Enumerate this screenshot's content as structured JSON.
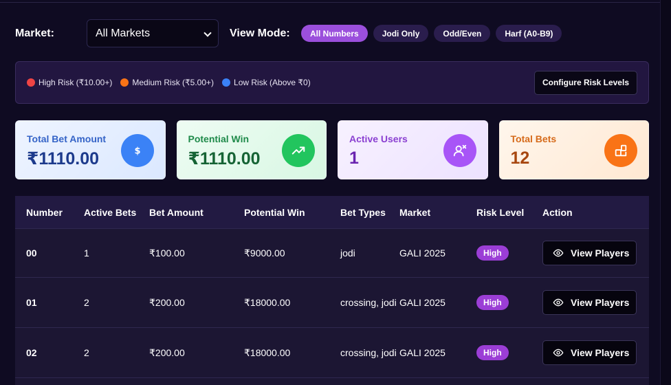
{
  "filters": {
    "market_label": "Market:",
    "market_selected": "All Markets",
    "view_mode_label": "View Mode:",
    "view_modes": [
      "All Numbers",
      "Jodi Only",
      "Odd/Even",
      "Harf (A0-B9)"
    ],
    "active_view_mode": "All Numbers"
  },
  "risk_legend": {
    "items": [
      {
        "label": "High Risk (₹10.00+)",
        "color": "#ef4444"
      },
      {
        "label": "Medium Risk (₹5.00+)",
        "color": "#f97316"
      },
      {
        "label": "Low Risk (Above ₹0)",
        "color": "#3b82f6"
      }
    ],
    "configure_button": "Configure Risk Levels"
  },
  "stats": [
    {
      "title": "Total Bet Amount",
      "value": "₹1110.00",
      "icon": "dollar-icon"
    },
    {
      "title": "Potential Win",
      "value": "₹1110.00",
      "icon": "trending-up-icon"
    },
    {
      "title": "Active Users",
      "value": "1",
      "icon": "users-icon"
    },
    {
      "title": "Total Bets",
      "value": "12",
      "icon": "shapes-icon"
    }
  ],
  "table": {
    "columns": [
      "Number",
      "Active Bets",
      "Bet Amount",
      "Potential Win",
      "Bet Types",
      "Market",
      "Risk Level",
      "Action"
    ],
    "rows": [
      {
        "number": "00",
        "active_bets": "1",
        "bet_amount": "₹100.00",
        "potential_win": "₹9000.00",
        "bet_types": "jodi",
        "market": "GALI 2025",
        "risk": "High",
        "action": "View Players"
      },
      {
        "number": "01",
        "active_bets": "2",
        "bet_amount": "₹200.00",
        "potential_win": "₹18000.00",
        "bet_types": "crossing, jodi",
        "market": "GALI 2025",
        "risk": "High",
        "action": "View Players"
      },
      {
        "number": "02",
        "active_bets": "2",
        "bet_amount": "₹200.00",
        "potential_win": "₹18000.00",
        "bet_types": "crossing, jodi",
        "market": "GALI 2025",
        "risk": "High",
        "action": "View Players"
      }
    ]
  }
}
